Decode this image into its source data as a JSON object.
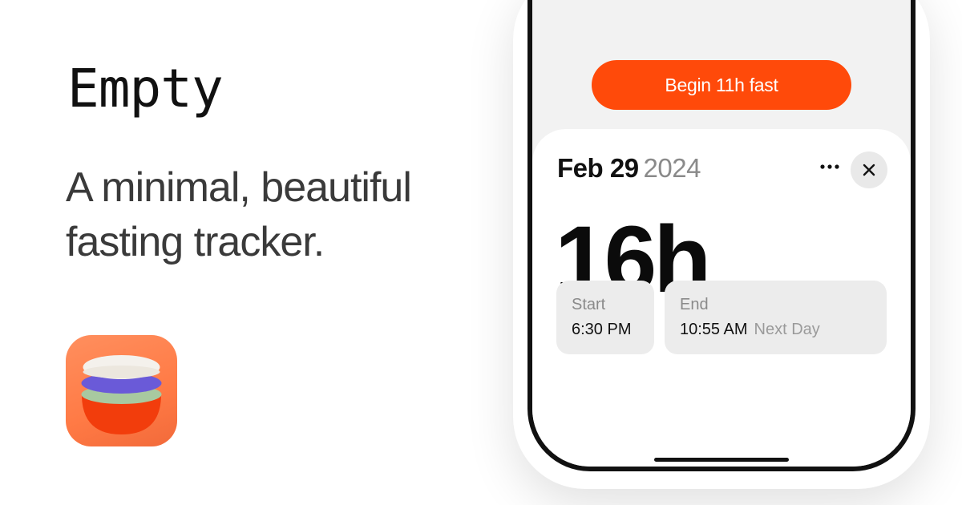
{
  "marketing": {
    "app_name": "Empty",
    "tagline": "A minimal, beautiful fasting tracker."
  },
  "app_icon": {
    "icon_name": "stacked-bowl-icon",
    "colors": {
      "background": "#ff7a45",
      "top_layer": "#f4f1ec",
      "middle_layer_1": "#6a5ad8",
      "middle_layer_2": "#a8c9a0",
      "bowl": "#f23d0c"
    }
  },
  "phone": {
    "begin_button_label": "Begin 11h fast",
    "sheet": {
      "date_main": "Feb 29",
      "date_year": "2024",
      "more_icon": "ellipsis-icon",
      "close_icon": "close-icon",
      "duration": "16h",
      "start": {
        "label": "Start",
        "value": "6:30 PM"
      },
      "end": {
        "label": "End",
        "value": "10:55 AM",
        "sub": "Next Day"
      }
    }
  },
  "colors": {
    "accent": "#ff4a0a",
    "text_primary": "#111111",
    "text_secondary": "#8a8a8a",
    "card_bg": "#ececec",
    "screen_bg": "#f2f2f2"
  }
}
